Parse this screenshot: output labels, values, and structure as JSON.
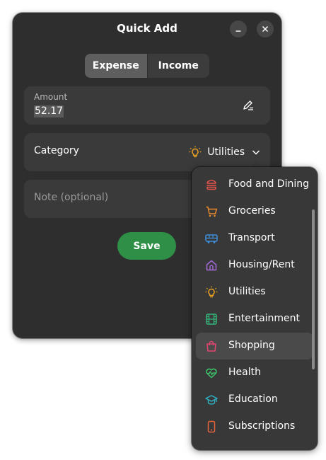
{
  "window": {
    "title": "Quick Add",
    "minimize_icon": "minimize-icon",
    "close_icon": "close-icon"
  },
  "type_toggle": {
    "options": [
      "Expense",
      "Income"
    ],
    "selected": "Expense"
  },
  "amount": {
    "caption": "Amount",
    "value": "52.17",
    "edit_icon": "edit-icon"
  },
  "category": {
    "label": "Category",
    "selected": "Utilities",
    "selected_icon": "lightbulb-icon",
    "chevron_icon": "chevron-down-icon"
  },
  "note": {
    "placeholder": "Note (optional)"
  },
  "save_button": {
    "label": "Save",
    "color": "#2f8f46"
  },
  "category_menu": {
    "items": [
      {
        "label": "Food and Dining",
        "icon": "burger-icon",
        "color": "#e5534b"
      },
      {
        "label": "Groceries",
        "icon": "cart-icon",
        "color": "#e8892b"
      },
      {
        "label": "Transport",
        "icon": "bus-icon",
        "color": "#3f8fdc"
      },
      {
        "label": "Housing/Rent",
        "icon": "house-icon",
        "color": "#a36ad8"
      },
      {
        "label": "Utilities",
        "icon": "lightbulb-icon",
        "color": "#e8a21f"
      },
      {
        "label": "Entertainment",
        "icon": "film-icon",
        "color": "#34b37a"
      },
      {
        "label": "Shopping",
        "icon": "shopping-bag-icon",
        "color": "#e2456f"
      },
      {
        "label": "Health",
        "icon": "heart-pulse-icon",
        "color": "#3ec46d"
      },
      {
        "label": "Education",
        "icon": "graduation-cap-icon",
        "color": "#2eb0c4"
      },
      {
        "label": "Subscriptions",
        "icon": "phone-icon",
        "color": "#e8643a"
      }
    ],
    "hovered": "Shopping"
  }
}
